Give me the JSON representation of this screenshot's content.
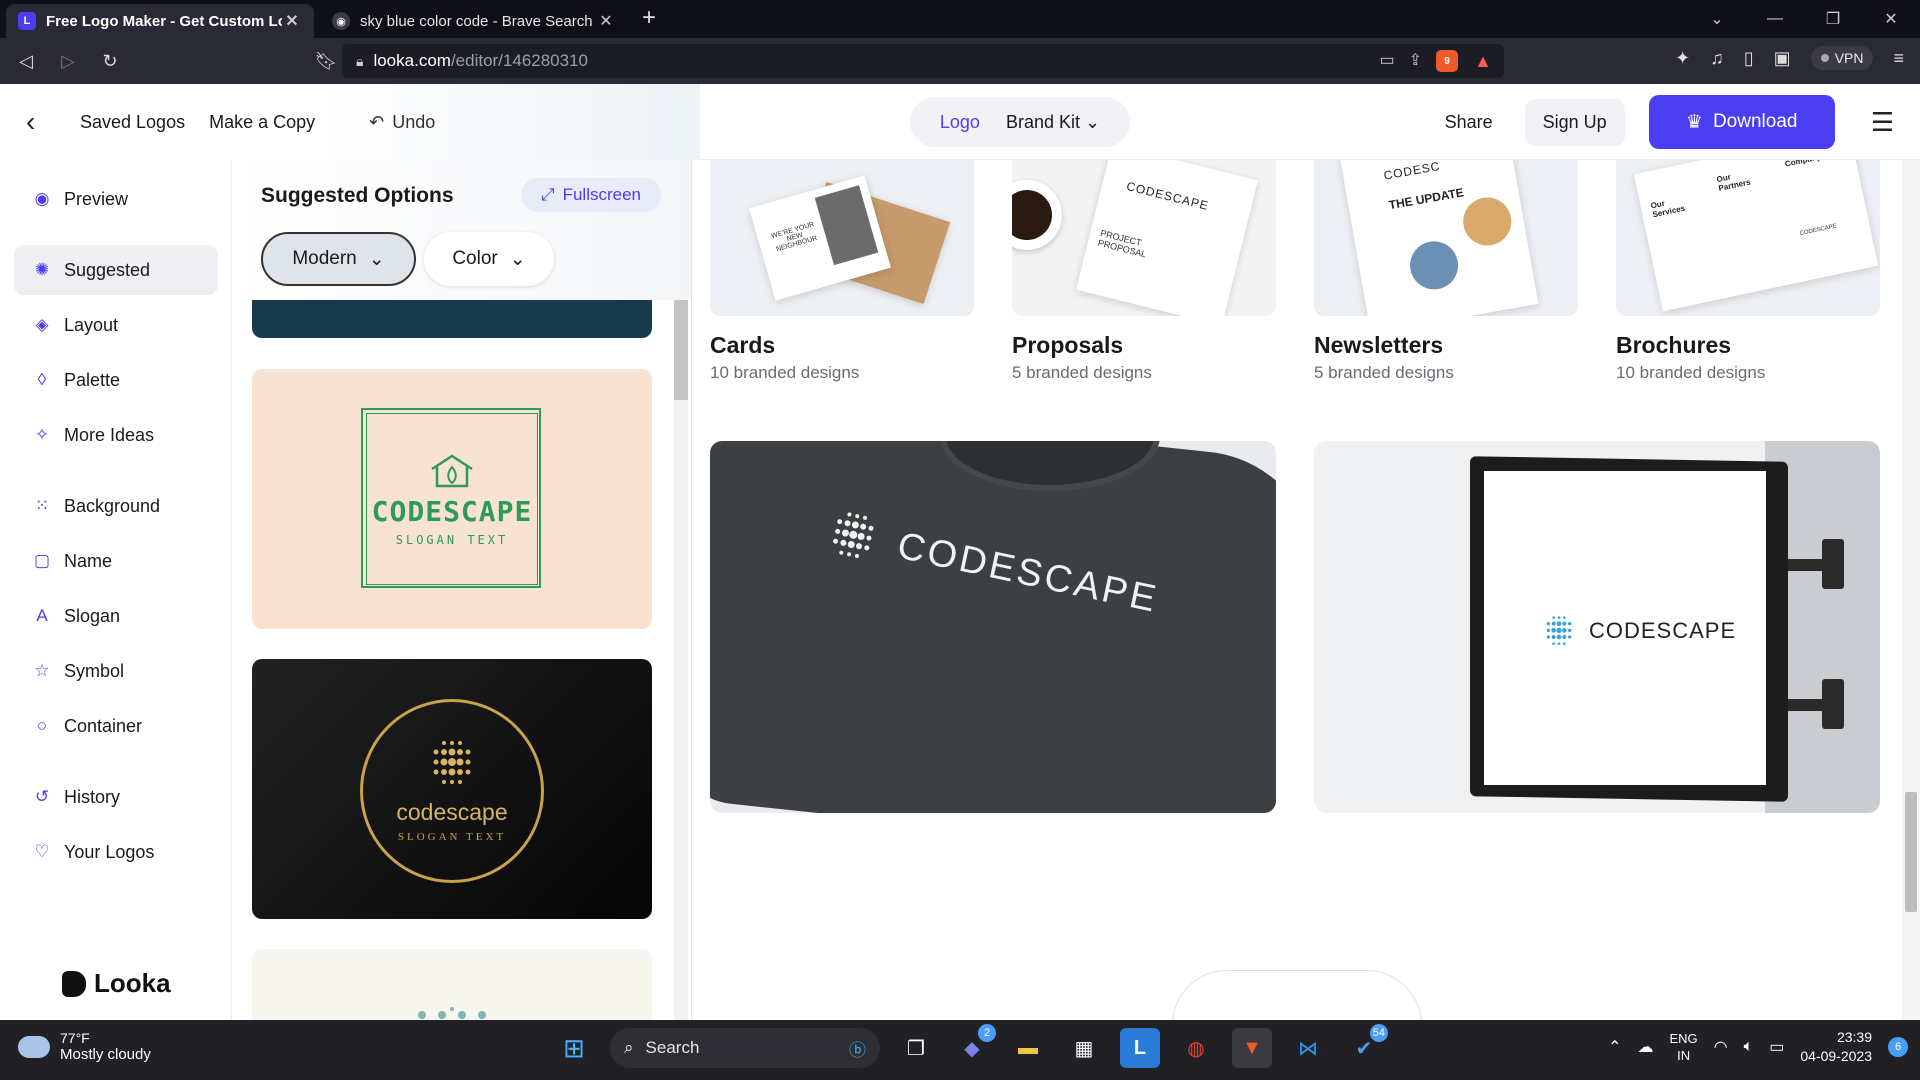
{
  "browser": {
    "tabs": [
      {
        "title": "Free Logo Maker - Get Custom Lo",
        "active": true,
        "icon": "looka-favicon"
      },
      {
        "title": "sky blue color code - Brave Search",
        "active": false,
        "icon": "brave-favicon"
      }
    ],
    "url_host": "looka.com",
    "url_path": "/editor/146280310",
    "shield_count": "9",
    "alert_count": "1",
    "vpn_label": "VPN"
  },
  "header": {
    "saved_logos": "Saved Logos",
    "make_copy": "Make a Copy",
    "undo": "Undo",
    "toggle_logo": "Logo",
    "toggle_brand_kit": "Brand Kit",
    "share": "Share",
    "sign_up": "Sign Up",
    "download": "Download",
    "accent_color": "#4b3df2"
  },
  "sidebar": {
    "items": [
      {
        "label": "Preview",
        "icon": "eye-icon"
      },
      {
        "label": "Suggested",
        "icon": "sparkle-icon",
        "active": true
      },
      {
        "label": "Layout",
        "icon": "layers-icon"
      },
      {
        "label": "Palette",
        "icon": "drop-icon"
      },
      {
        "label": "More Ideas",
        "icon": "wand-icon"
      },
      {
        "label": "Background",
        "icon": "grid-dots-icon"
      },
      {
        "label": "Name",
        "icon": "text-box-icon"
      },
      {
        "label": "Slogan",
        "icon": "slogan-icon"
      },
      {
        "label": "Symbol",
        "icon": "star-icon"
      },
      {
        "label": "Container",
        "icon": "circle-icon"
      },
      {
        "label": "History",
        "icon": "history-icon"
      },
      {
        "label": "Your Logos",
        "icon": "heart-icon"
      }
    ],
    "brand": "Looka"
  },
  "suggested": {
    "title": "Suggested Options",
    "fullscreen": "Fullscreen",
    "filter_style": "Modern",
    "filter_color": "Color",
    "peach_logo": {
      "name": "CODESCAPE",
      "slogan": "SLOGAN TEXT",
      "color": "#2d9a55"
    },
    "black_logo": {
      "name": "codescape",
      "slogan": "SLOGAN TEXT",
      "color": "#c9a24a"
    }
  },
  "brand_kit": {
    "categories": [
      {
        "name": "Cards",
        "count": "10 branded designs"
      },
      {
        "name": "Proposals",
        "count": "5 branded designs"
      },
      {
        "name": "Newsletters",
        "count": "5 branded designs"
      },
      {
        "name": "Brochures",
        "count": "10 branded designs"
      }
    ],
    "tile_text": {
      "card_note": "WE'RE YOUR NEW NEIGHBOUR",
      "proposal_brand": "CODESCAPE",
      "proposal_title": "PROJECT PROPOSAL",
      "newsletter_brand": "CODESC",
      "newsletter_title": "THE UPDATE",
      "brochure_a": "Our Services",
      "brochure_b": "Our Partners",
      "brochure_c": "About Company",
      "brochure_brand": "CODESCAPE"
    },
    "shirt_brand": "CODESCAPE",
    "sign_brand": "CODESCAPE"
  },
  "taskbar": {
    "temperature": "77°F",
    "condition": "Mostly cloudy",
    "search": "Search",
    "teams_badge": "2",
    "todo_badge": "54",
    "lang_line1": "ENG",
    "lang_line2": "IN",
    "time": "23:39",
    "date": "04-09-2023",
    "notifications": "6"
  }
}
